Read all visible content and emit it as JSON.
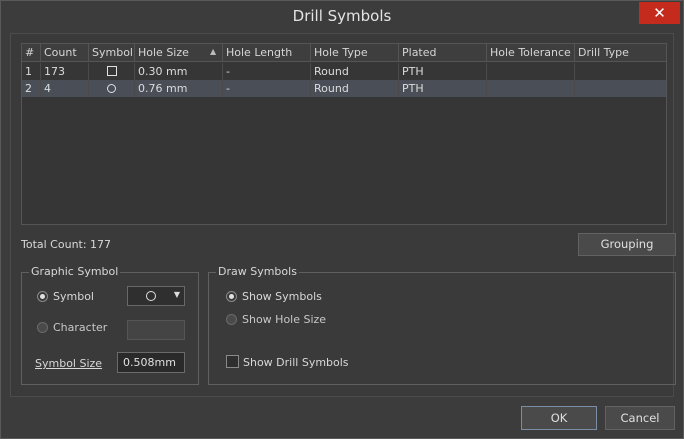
{
  "window": {
    "title": "Drill Symbols",
    "close_glyph": "✕"
  },
  "grid": {
    "columns": [
      "#",
      "Count",
      "Symbol",
      "Hole Size",
      "Hole Length",
      "Hole Type",
      "Plated",
      "Hole Tolerance",
      "Drill Type"
    ],
    "sort_column": "Hole Size",
    "rows": [
      {
        "index": "1",
        "count": "173",
        "symbol": "square-symbol-icon",
        "hole_size": "0.30 mm",
        "hole_length": "-",
        "hole_type": "Round",
        "plated": "PTH",
        "hole_tolerance": "",
        "drill_type": "",
        "selected": false
      },
      {
        "index": "2",
        "count": "4",
        "symbol": "circle-symbol-icon",
        "hole_size": "0.76 mm",
        "hole_length": "-",
        "hole_type": "Round",
        "plated": "PTH",
        "hole_tolerance": "",
        "drill_type": "",
        "selected": true
      }
    ]
  },
  "total_count_label": "Total Count: 177",
  "grouping_button": "Grouping",
  "graphic_symbol": {
    "title": "Graphic Symbol",
    "symbol_label": "Symbol",
    "symbol_selected": true,
    "symbol_combo_value": "circle-symbol-icon",
    "character_label": "Character",
    "character_selected": false,
    "size_label": "Symbol Size",
    "size_value": "0.508mm"
  },
  "draw_symbols": {
    "title": "Draw Symbols",
    "show_symbols_label": "Show Symbols",
    "show_symbols_selected": true,
    "show_hole_size_label": "Show Hole Size",
    "show_hole_size_selected": false,
    "show_drill_symbols_label": "Show Drill Symbols",
    "show_drill_symbols_checked": false
  },
  "footer": {
    "ok_label": "OK",
    "cancel_label": "Cancel"
  },
  "colors": {
    "accent_close": "#c42b1c",
    "selection": "#4a4f57"
  }
}
